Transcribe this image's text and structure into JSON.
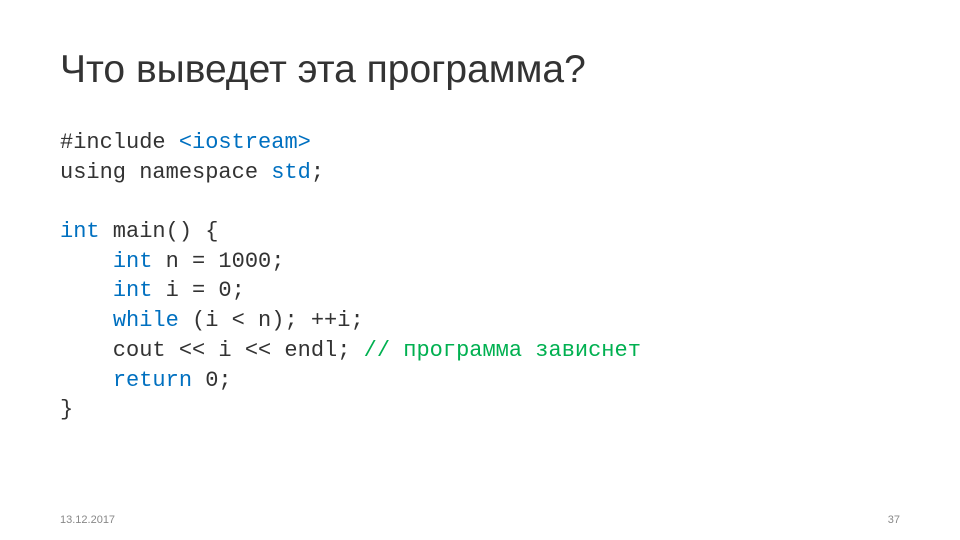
{
  "slide": {
    "title": "Что выведет эта программа?",
    "code": {
      "t1a": "#include ",
      "t1b": "<iostream>",
      "t2a": "using namespace ",
      "t2b": "std",
      "t2c": ";",
      "t3a": "int",
      "t3b": " main() {",
      "t4a": "    ",
      "t4b": "int",
      "t4c": " n = 1000;",
      "t5a": "    ",
      "t5b": "int",
      "t5c": " i = 0;",
      "t6a": "    ",
      "t6b": "while",
      "t6c": " (i < n); ++i;",
      "t7a": "    cout << i << endl; ",
      "t7b": "// программа зависнет",
      "t8a": "    ",
      "t8b": "return",
      "t8c": " 0;",
      "t9": "}"
    },
    "foot_left": "13.12.2017",
    "foot_right": "37"
  }
}
